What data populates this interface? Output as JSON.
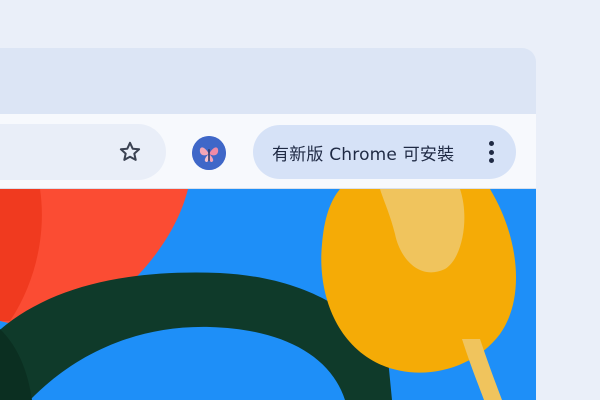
{
  "toolbar": {
    "bookmark_icon": "star-outline-icon",
    "profile_icon": "butterfly-avatar-icon",
    "update_button_label": "有新版 Chrome 可安裝",
    "menu_icon": "three-dots-vertical-icon"
  },
  "colors": {
    "page_background": "#eaeff9",
    "tab_strip": "#dce5f5",
    "toolbar": "#f7f9fd",
    "update_chip": "#d6e2f7",
    "wallpaper_sky": "#1e8ff8",
    "flower_red": "#fb4c33",
    "flower_yellow": "#f5ab06",
    "leaf_dark_green": "#0f3a2a"
  }
}
